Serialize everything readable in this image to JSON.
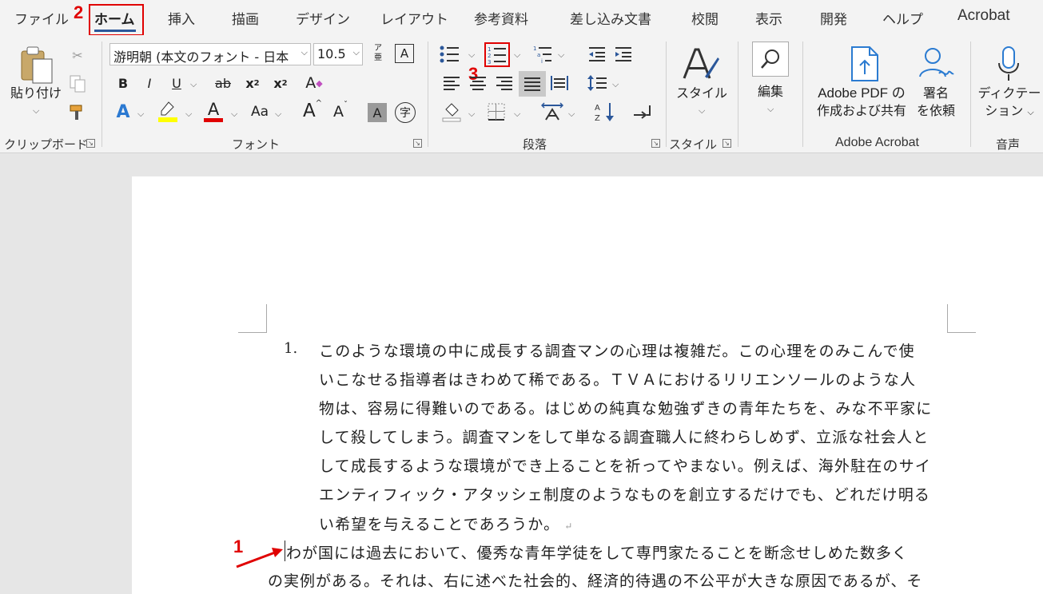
{
  "tabs": [
    {
      "label": "ファイル",
      "active": false
    },
    {
      "label": "ホーム",
      "active": true
    },
    {
      "label": "挿入",
      "active": false
    },
    {
      "label": "描画",
      "active": false
    },
    {
      "label": "デザイン",
      "active": false
    },
    {
      "label": "レイアウト",
      "active": false
    },
    {
      "label": "参考資料",
      "active": false
    },
    {
      "label": "差し込み文書",
      "active": false
    },
    {
      "label": "校閲",
      "active": false
    },
    {
      "label": "表示",
      "active": false
    },
    {
      "label": "開発",
      "active": false
    },
    {
      "label": "ヘルプ",
      "active": false
    },
    {
      "label": "Acrobat",
      "active": false
    }
  ],
  "annotations": {
    "m1": "1",
    "m2": "2",
    "m3": "3",
    "color": "#e00000"
  },
  "clipboard": {
    "paste_label": "貼り付け",
    "group_label": "クリップボード"
  },
  "font": {
    "font_name": "游明朝 (本文のフォント - 日本",
    "font_size": "10.5",
    "group_label": "フォント",
    "bold": "B",
    "italic": "I",
    "underline": "U",
    "strike": "ab",
    "subscript": "x",
    "sub_mark": "2",
    "superscript": "x",
    "sup_mark": "2",
    "text_effects": "A",
    "font_color": "A",
    "change_case": "Aa",
    "grow": "A",
    "shrink": "A",
    "char_shading": "A",
    "enclose": "字",
    "clear_format": "A",
    "phonetic_top": "ア",
    "phonetic_bottom": "亜",
    "char_border": "A",
    "highlight_color": "#ffff00",
    "font_color_bar": "#e00000"
  },
  "paragraph": {
    "group_label": "段落"
  },
  "styles": {
    "label": "スタイル",
    "group_label": "スタイル"
  },
  "editing": {
    "label": "編集"
  },
  "acrobat": {
    "create_share_line1": "Adobe PDF の",
    "create_share_line2": "作成および共有",
    "sign_line1": "署名",
    "sign_line2": "を依頼",
    "group_label": "Adobe Acrobat"
  },
  "voice": {
    "dictate_line1": "ディクテー",
    "dictate_line2": "ション",
    "group_label": "音声"
  },
  "document": {
    "list_number": "1.",
    "list_paragraph": [
      "このような環境の中に成長する調査マンの心理は複雑だ。この心理をのみこんで使",
      "いこなせる指導者はきわめて稀である。ＴＶＡにおけるリリエンソールのような人",
      "物は、容易に得難いのである。はじめの純真な勉強ずきの青年たちを、みな不平家に",
      "して殺してしまう。調査マンをして単なる調査職人に終わらしめず、立派な社会人と",
      "して成長するような環境ができ上ることを祈ってやまない。例えば、海外駐在のサイ",
      "エンティフィック・アタッシェ制度のようなものを創立するだけでも、どれだけ明る",
      "い希望を与えることであろうか。"
    ],
    "return_mark": "↵",
    "body_paragraph": [
      "わが国には過去において、優秀な青年学徒をして専門家たることを断念せしめた数多く",
      "の実例がある。それは、右に述べた社会的、経済的待遇の不公平が大きな原因であるが、そ"
    ]
  },
  "colors": {
    "tab_underline": "#2b579a",
    "ribbon_bg": "#f3f3f3",
    "workspace_bg": "#e6e6e6",
    "icon_blue": "#2b579a"
  }
}
